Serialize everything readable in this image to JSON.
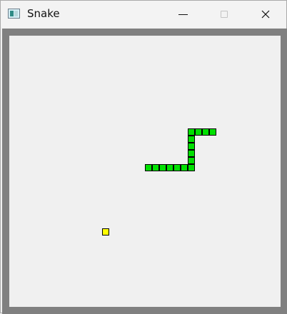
{
  "window": {
    "title": "Snake"
  },
  "icons": {
    "app": "app-icon",
    "minimize": "minimize-icon",
    "maximize": "maximize-icon",
    "close": "close-icon"
  },
  "colors": {
    "border": "#808080",
    "field": "#f0f0f0",
    "snake": "#00e000",
    "food": "#ffff00",
    "outline": "#000000"
  },
  "game": {
    "grid_columns": 38,
    "grid_rows": 38,
    "snake": [
      {
        "col": 19,
        "row": 18
      },
      {
        "col": 20,
        "row": 18
      },
      {
        "col": 21,
        "row": 18
      },
      {
        "col": 22,
        "row": 18
      },
      {
        "col": 23,
        "row": 18
      },
      {
        "col": 24,
        "row": 18
      },
      {
        "col": 25,
        "row": 18
      },
      {
        "col": 25,
        "row": 17
      },
      {
        "col": 25,
        "row": 16
      },
      {
        "col": 25,
        "row": 15
      },
      {
        "col": 25,
        "row": 14
      },
      {
        "col": 25,
        "row": 13
      },
      {
        "col": 26,
        "row": 13
      },
      {
        "col": 27,
        "row": 13
      },
      {
        "col": 28,
        "row": 13
      }
    ],
    "food": {
      "col": 13,
      "row": 27
    }
  }
}
